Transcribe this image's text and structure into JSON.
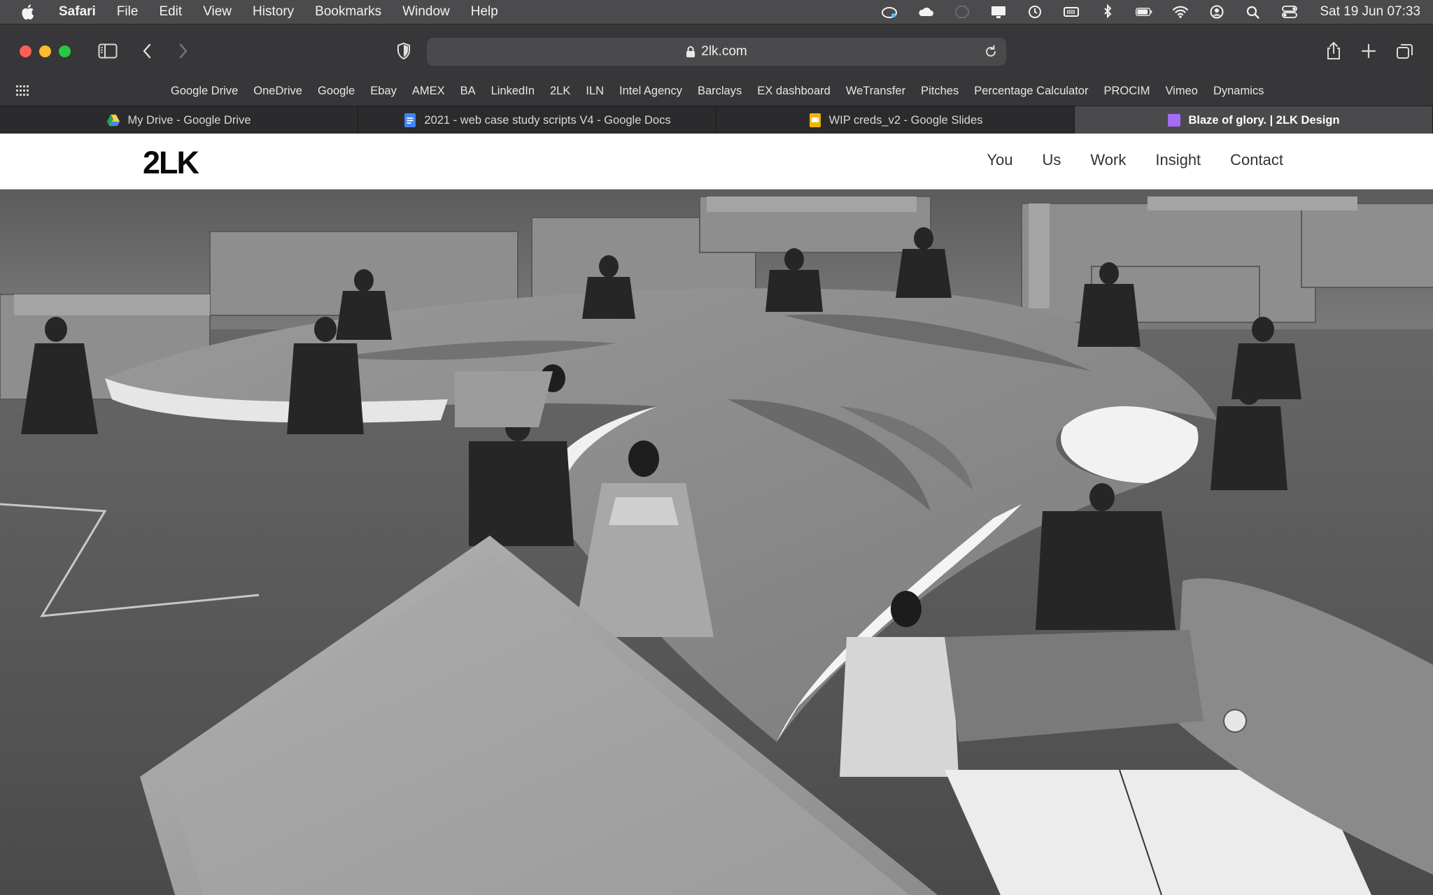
{
  "menubar": {
    "app": "Safari",
    "menus": [
      "File",
      "Edit",
      "View",
      "History",
      "Bookmarks",
      "Window",
      "Help"
    ],
    "clock": "Sat 19 Jun  07:33",
    "status_icons": [
      "creative-cloud-icon",
      "icloud-icon",
      "adblock-icon",
      "display-icon",
      "time-machine-icon",
      "memory-icon",
      "bluetooth-icon",
      "battery-icon",
      "wifi-icon",
      "user-icon",
      "spotlight-icon",
      "control-center-icon"
    ]
  },
  "browser": {
    "url": "2lk.com",
    "bookmarks": [
      "Google Drive",
      "OneDrive",
      "Google",
      "Ebay",
      "AMEX",
      "BA",
      "LinkedIn",
      "2LK",
      "ILN",
      "Intel Agency",
      "Barclays",
      "EX dashboard",
      "WeTransfer",
      "Pitches",
      "Percentage Calculator",
      "PROCIM",
      "Vimeo",
      "Dynamics"
    ],
    "tabs": [
      {
        "title": "My Drive - Google Drive",
        "icon": "google-drive-icon",
        "active": false
      },
      {
        "title": "2021 - web case study scripts V4 - Google Docs",
        "icon": "google-docs-icon",
        "active": false
      },
      {
        "title": "WIP creds_v2 - Google Slides",
        "icon": "google-slides-icon",
        "active": false
      },
      {
        "title": "Blaze of glory. | 2LK Design",
        "icon": "purple-square-icon",
        "active": true
      }
    ]
  },
  "site": {
    "logo": "2LK",
    "nav": [
      "You",
      "Us",
      "Work",
      "Insight",
      "Contact"
    ]
  },
  "colors": {
    "menubar": "#4b4b4d",
    "chrome": "#373739",
    "active_tab": "#4a4a4c",
    "traffic_red": "#fe5f57",
    "traffic_yellow": "#febc2e",
    "traffic_green": "#28c840"
  }
}
